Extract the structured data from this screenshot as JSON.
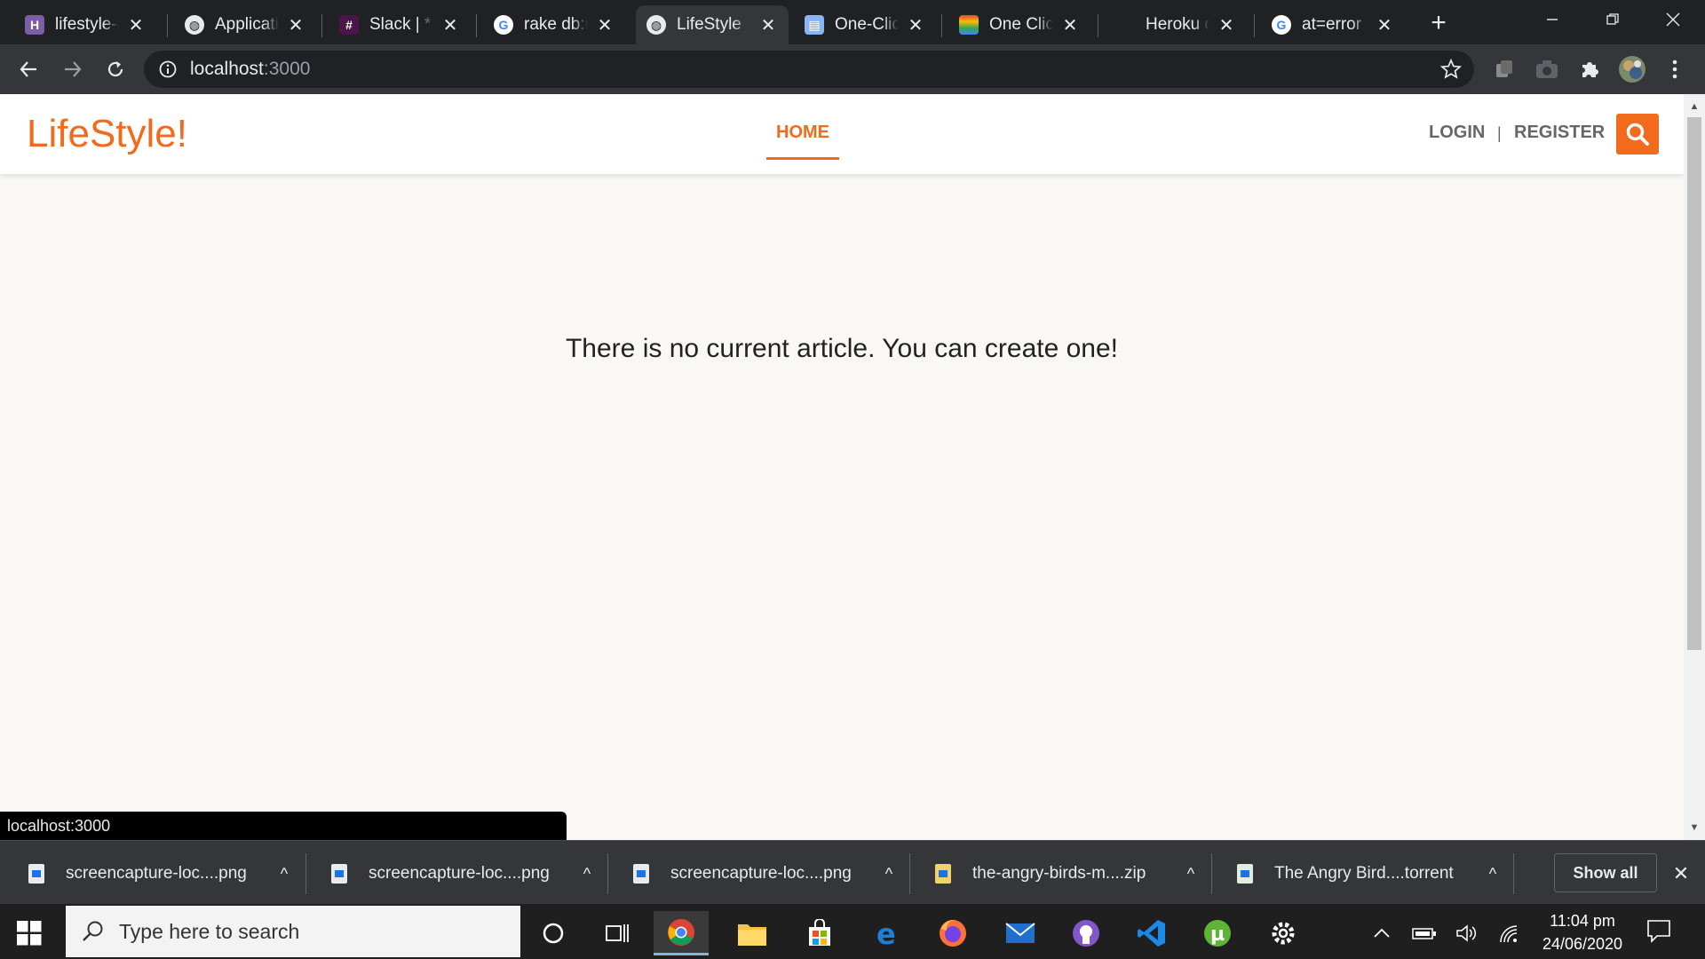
{
  "browser": {
    "tabs": [
      {
        "title": "lifestyle-ar",
        "favicon": "heroku-icon",
        "active": false
      },
      {
        "title": "Applicatio",
        "favicon": "globe-icon",
        "active": false
      },
      {
        "title": "Slack | * fu",
        "favicon": "slack-icon",
        "active": false
      },
      {
        "title": "rake db:m",
        "favicon": "google-icon",
        "active": false
      },
      {
        "title": "LifeStyle",
        "favicon": "globe-icon",
        "active": true
      },
      {
        "title": "One-Click",
        "favicon": "doc-icon",
        "active": false
      },
      {
        "title": "One Click",
        "favicon": "rainbow-icon",
        "active": false
      },
      {
        "title": "Heroku de",
        "favicon": "none",
        "active": false
      },
      {
        "title": "at=error c",
        "favicon": "google-icon",
        "active": false
      }
    ],
    "url_host": "localhost",
    "url_port": ":3000",
    "status_url": "localhost:3000"
  },
  "site": {
    "logo": "LifeStyle!",
    "nav_home": "HOME",
    "nav_login": "LOGIN",
    "nav_separator": "|",
    "nav_register": "REGISTER",
    "empty_message": "There is no current article. You can create one!",
    "accent_color": "#f26b1d"
  },
  "downloads": {
    "items": [
      {
        "name": "screencapture-loc....png"
      },
      {
        "name": "screencapture-loc....png"
      },
      {
        "name": "screencapture-loc....png"
      },
      {
        "name": "the-angry-birds-m....zip"
      },
      {
        "name": "The Angry Bird....torrent"
      }
    ],
    "show_all": "Show all"
  },
  "taskbar": {
    "search_placeholder": "Type here to search",
    "time": "11:04 pm",
    "date": "24/06/2020"
  }
}
